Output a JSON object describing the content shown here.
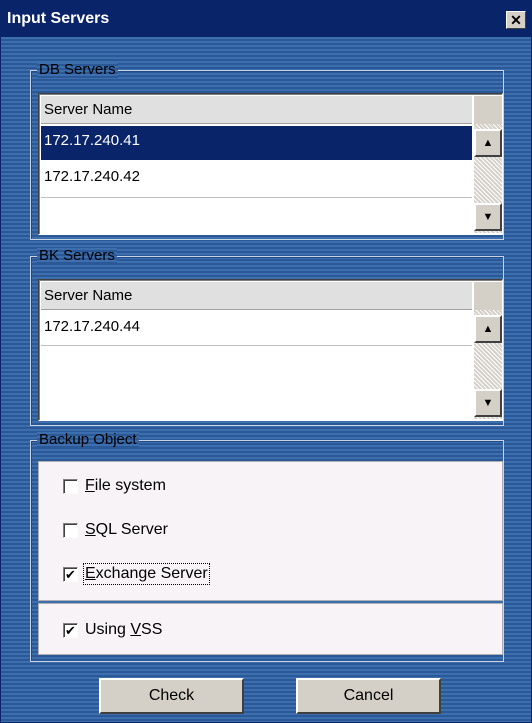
{
  "window": {
    "title": "Input Servers"
  },
  "db_servers": {
    "legend": "DB Servers",
    "column_header": "Server Name",
    "rows": [
      "172.17.240.41",
      "172.17.240.42"
    ],
    "selected_index": 0
  },
  "bk_servers": {
    "legend": "BK Servers",
    "column_header": "Server Name",
    "rows": [
      "172.17.240.44"
    ]
  },
  "backup_object": {
    "legend": "Backup Object",
    "options": [
      {
        "label": "File system",
        "mnemonic": "F",
        "rest": "ile system",
        "checked": false
      },
      {
        "label": "SQL Server",
        "mnemonic": "S",
        "rest": "QL Server",
        "checked": false
      },
      {
        "label": "Exchange Server",
        "mnemonic": "E",
        "rest": "xchange Server",
        "checked": true,
        "focused": true
      }
    ],
    "vss": {
      "label": "Using VSS",
      "prefix": "Using ",
      "mnemonic": "V",
      "rest": "SS",
      "checked": true
    }
  },
  "buttons": {
    "check": "Check",
    "cancel": "Cancel"
  },
  "icons": {
    "close": "close-icon",
    "scroll_up": "scroll-up-icon",
    "scroll_down": "scroll-down-icon",
    "checkmark": "checkmark-icon"
  },
  "colors": {
    "titlebar": "#0a246a",
    "selection": "#0a246a",
    "dialog_bg": "#3d6fae",
    "button_face": "#d4d0c8"
  }
}
